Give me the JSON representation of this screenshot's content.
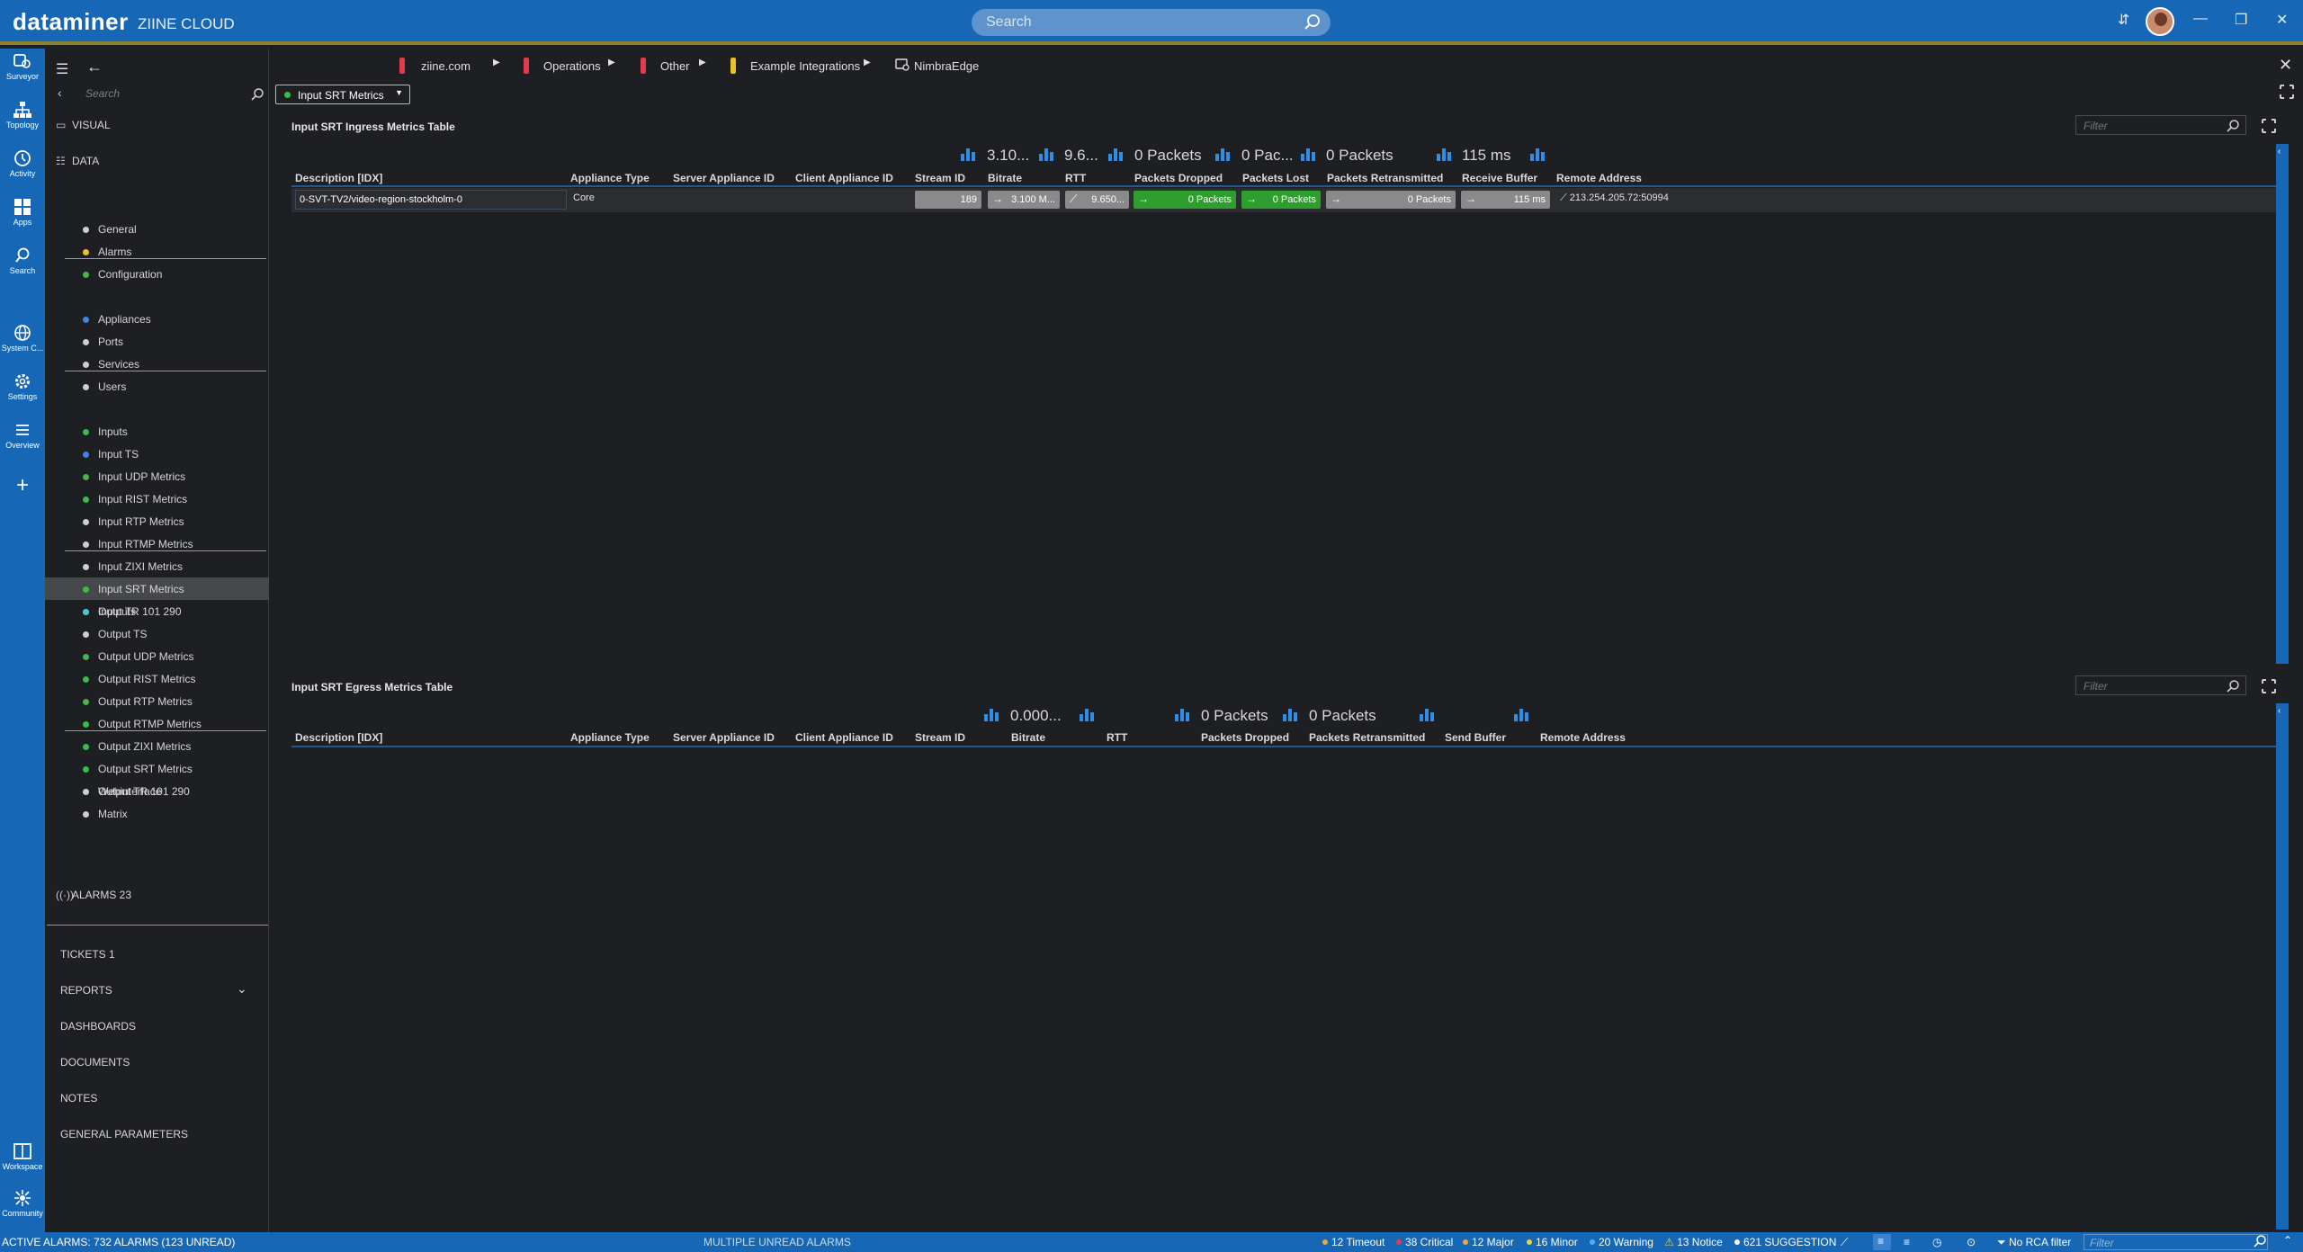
{
  "app": {
    "brand": "dataminer",
    "cloud": "ZIINE CLOUD",
    "search_placeholder": "Search"
  },
  "rail": [
    {
      "label": "Surveyor",
      "icon": "surveyor-icon"
    },
    {
      "label": "Topology",
      "icon": "topology-icon"
    },
    {
      "label": "Activity",
      "icon": "activity-icon"
    },
    {
      "label": "Apps",
      "icon": "apps-icon"
    },
    {
      "label": "Search",
      "icon": "search-icon"
    },
    {
      "label": "System C...",
      "icon": "globe-icon"
    },
    {
      "label": "Settings",
      "icon": "gear-icon"
    },
    {
      "label": "Overview",
      "icon": "list-icon"
    },
    {
      "label": "Workspace",
      "icon": "workspace-icon"
    },
    {
      "label": "Community",
      "icon": "community-icon"
    }
  ],
  "breadcrumb": [
    {
      "label": "ziine.com",
      "color": "#e23b4a"
    },
    {
      "label": "Operations",
      "color": "#e23b4a"
    },
    {
      "label": "Other",
      "color": "#e23b4a"
    },
    {
      "label": "Example Integrations",
      "color": "#e8c22a"
    },
    {
      "label": "NimbraEdge",
      "color": ""
    }
  ],
  "nav": {
    "search_placeholder": "Search",
    "visual": "VISUAL",
    "data": "DATA",
    "groups": [
      [
        {
          "label": "General",
          "color": "#cfcfcf"
        },
        {
          "label": "Alarms",
          "color": "#e8c22a"
        },
        {
          "label": "Configuration",
          "color": "#3fb94c"
        }
      ],
      [
        {
          "label": "Appliances",
          "color": "#3d86e0"
        },
        {
          "label": "Ports",
          "color": "#cfcfcf"
        },
        {
          "label": "Services",
          "color": "#cfcfcf"
        },
        {
          "label": "Users",
          "color": "#cfcfcf"
        }
      ],
      [
        {
          "label": "Inputs",
          "color": "#3fb94c"
        },
        {
          "label": "Input TS",
          "color": "#3d86e0"
        },
        {
          "label": "Input UDP Metrics",
          "color": "#3fb94c"
        },
        {
          "label": "Input RIST Metrics",
          "color": "#3fb94c"
        },
        {
          "label": "Input RTP Metrics",
          "color": "#cfcfcf"
        },
        {
          "label": "Input RTMP Metrics",
          "color": "#cfcfcf"
        },
        {
          "label": "Input ZIXI Metrics",
          "color": "#cfcfcf"
        },
        {
          "label": "Input SRT Metrics",
          "color": "#3fb94c",
          "selected": true
        },
        {
          "label": "Input TR 101 290",
          "color": "#cfcfcf"
        }
      ],
      [
        {
          "label": "Outputs",
          "color": "#3fc9d0"
        },
        {
          "label": "Output TS",
          "color": "#cfcfcf"
        },
        {
          "label": "Output UDP Metrics",
          "color": "#3fb94c"
        },
        {
          "label": "Output RIST Metrics",
          "color": "#3fb94c"
        },
        {
          "label": "Output RTP Metrics",
          "color": "#3fb94c"
        },
        {
          "label": "Output RTMP Metrics",
          "color": "#3fb94c"
        },
        {
          "label": "Output ZIXI Metrics",
          "color": "#3fb94c"
        },
        {
          "label": "Output SRT Metrics",
          "color": "#3fb94c"
        },
        {
          "label": "Output TR 101 290",
          "color": "#3fb94c"
        }
      ],
      [
        {
          "label": "Webinterface",
          "color": "#cfcfcf"
        },
        {
          "label": "Matrix",
          "color": "#cfcfcf"
        }
      ]
    ],
    "alarms": "ALARMS 23",
    "bottom": [
      "TICKETS 1",
      "REPORTS",
      "DASHBOARDS",
      "DOCUMENTS",
      "NOTES",
      "GENERAL PARAMETERS"
    ]
  },
  "page_selector": "Input SRT Metrics",
  "ingress": {
    "title": "Input SRT Ingress Metrics Table",
    "filter_placeholder": "Filter",
    "columns": [
      "Description [IDX]",
      "Appliance Type",
      "Server Appliance ID",
      "Client Appliance ID",
      "Stream ID",
      "Bitrate",
      "RTT",
      "Packets Dropped",
      "Packets Lost",
      "Packets Retransmitted",
      "Receive Buffer",
      "Remote Address"
    ],
    "aggregates": {
      "bitrate": "3.10...",
      "rtt": "9.6...",
      "dropped": "0 Packets",
      "lost": "0 Pac...",
      "retransmitted": "0 Packets",
      "buffer": "115 ms"
    },
    "row": {
      "description": "0-SVT-TV2/video-region-stockholm-0",
      "appliance_type": "Core",
      "server_id": "",
      "client_id": "",
      "stream_id": "189",
      "bitrate": "3.100 M...",
      "rtt": "9.650...",
      "dropped": "0 Packets",
      "lost": "0 Packets",
      "retransmitted": "0 Packets",
      "buffer": "115 ms",
      "remote": "213.254.205.72:50994"
    }
  },
  "egress": {
    "title": "Input SRT Egress Metrics Table",
    "filter_placeholder": "Filter",
    "columns": [
      "Description [IDX]",
      "Appliance Type",
      "Server Appliance ID",
      "Client Appliance ID",
      "Stream ID",
      "Bitrate",
      "RTT",
      "Packets Dropped",
      "Packets Retransmitted",
      "Send Buffer",
      "Remote Address"
    ],
    "aggregates": {
      "bitrate": "0.000...",
      "dropped": "0 Packets",
      "retransmitted": "0 Packets"
    }
  },
  "status": {
    "active_alarms": "ACTIVE ALARMS: 732 ALARMS (123 UNREAD)",
    "unread": "MULTIPLE UNREAD ALARMS",
    "counts": [
      {
        "label": "12 Timeout",
        "color": "#f2a53c"
      },
      {
        "label": "38 Critical",
        "color": "#e23b4a"
      },
      {
        "label": "12 Major",
        "color": "#f2a53c"
      },
      {
        "label": "16 Minor",
        "color": "#e8d23a"
      },
      {
        "label": "20 Warning",
        "color": "#4ab0ff"
      },
      {
        "label": "13 Notice",
        "color": "#e8d23a"
      },
      {
        "label": "621 SUGGESTION",
        "color": "#ffffff"
      }
    ],
    "rca": "No RCA filter",
    "filter_placeholder": "Filter"
  }
}
